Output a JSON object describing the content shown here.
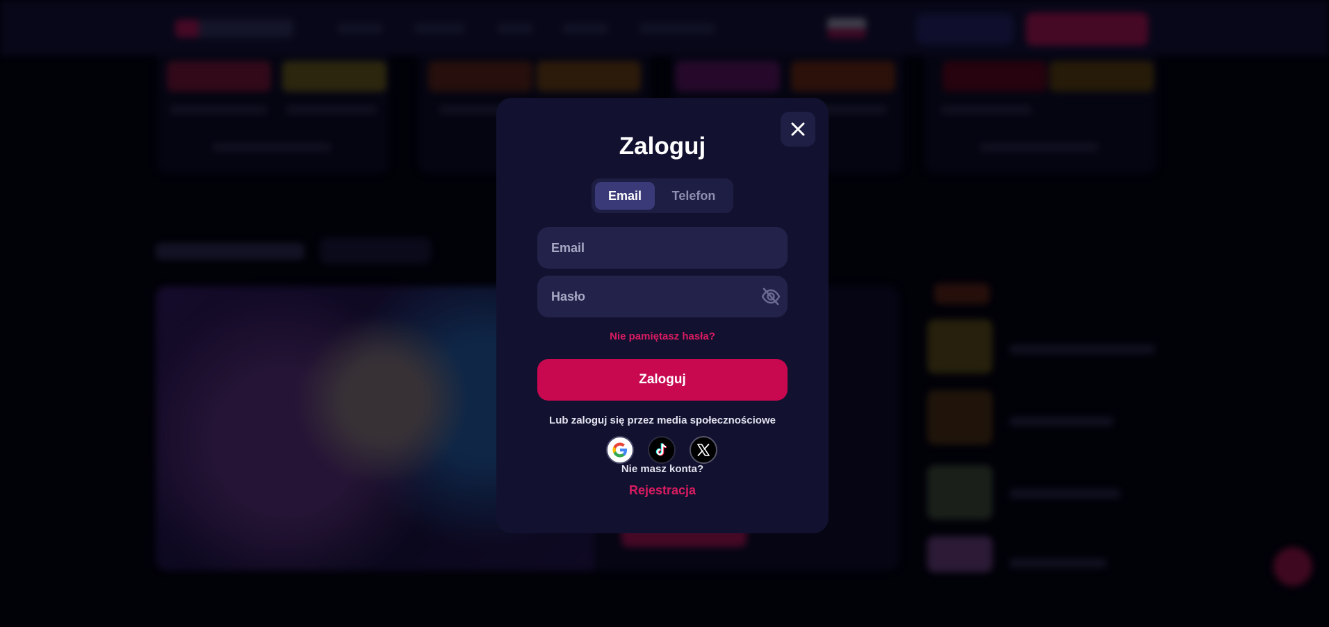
{
  "modal": {
    "title": "Zaloguj",
    "tabs": [
      {
        "label": "Email",
        "active": true
      },
      {
        "label": "Telefon",
        "active": false
      }
    ],
    "email_placeholder": "Email",
    "password_placeholder": "Hasło",
    "forgot_password": "Nie pamiętasz hasła?",
    "submit_label": "Zaloguj",
    "social_text": "Lub zaloguj się przez media społecznościowe",
    "social_providers": [
      "google-icon",
      "tiktok-icon",
      "x-icon"
    ],
    "no_account_text": "Nie masz konta?",
    "register_link": "Rejestracja",
    "close_icon": "close-icon",
    "password_toggle_icon": "eye-off-icon"
  },
  "colors": {
    "modal_bg": "#121230",
    "field_bg": "#22224a",
    "accent": "#c8084f",
    "link": "#d81b60",
    "tab_active": "#3a3a78"
  }
}
